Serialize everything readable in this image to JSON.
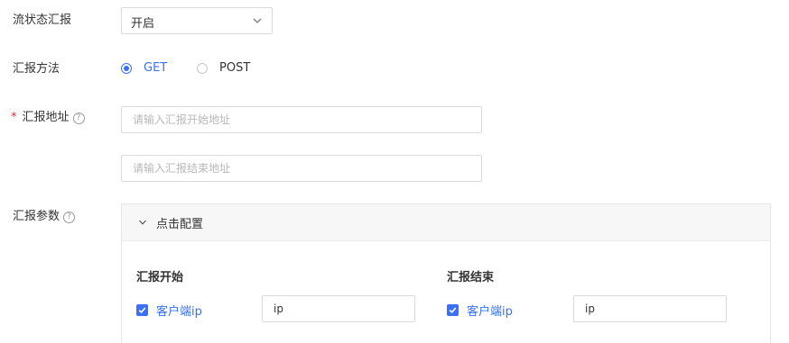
{
  "flow_status": {
    "label": "流状态汇报",
    "selected": "开启"
  },
  "report_method": {
    "label": "汇报方法",
    "options": [
      "GET",
      "POST"
    ],
    "selected": "GET"
  },
  "report_address": {
    "required_mark": "*",
    "label": "汇报地址",
    "help": "?",
    "start_placeholder": "请输入汇报开始地址",
    "end_placeholder": "请输入汇报结束地址"
  },
  "report_params": {
    "label": "汇报参数",
    "help": "?",
    "panel_title": "点击配置",
    "start": {
      "title": "汇报开始",
      "checkbox_label": "客户端ip",
      "checked": true,
      "value": "ip"
    },
    "end": {
      "title": "汇报结束",
      "checkbox_label": "客户端ip",
      "checked": true,
      "value": "ip"
    }
  },
  "colors": {
    "accent": "#3a6ff7",
    "required": "#f5222d",
    "border": "#d9d9d9"
  },
  "icons": {
    "select_arrow": "chevron-down-icon",
    "panel_toggle": "chevron-down-icon",
    "help": "help-circle-icon",
    "check": "check-icon"
  }
}
